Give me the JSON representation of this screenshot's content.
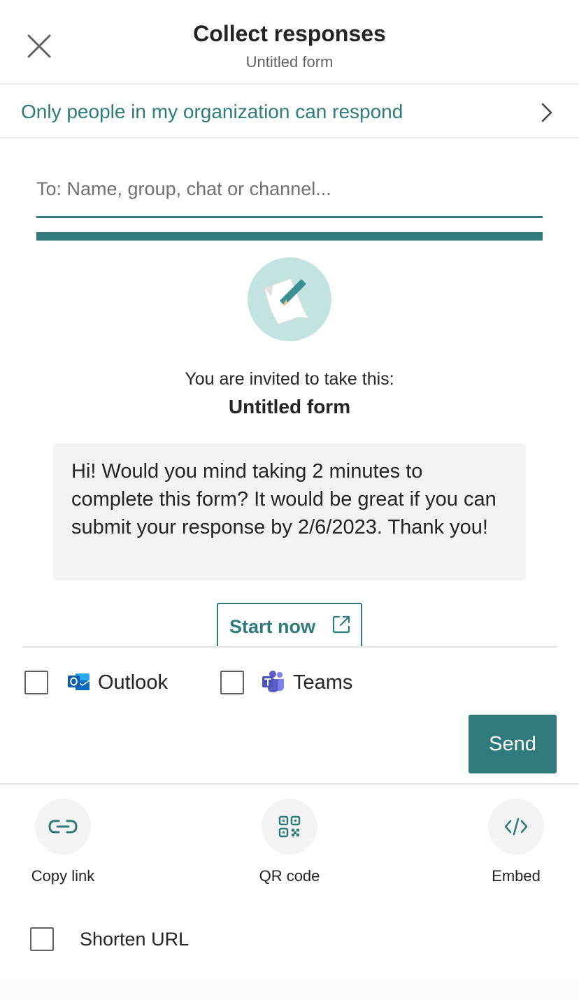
{
  "header": {
    "title": "Collect responses",
    "subtitle": "Untitled form"
  },
  "permission": {
    "label": "Only people in my organization can respond"
  },
  "recipients": {
    "placeholder": "To: Name, group, chat or channel...",
    "value": ""
  },
  "preview": {
    "invite_text": "You are invited to take this:",
    "form_title": "Untitled form",
    "message": "Hi! Would you mind taking 2 minutes to complete this form? It would be great if you can submit your response by 2/6/2023. Thank you!",
    "start_label": "Start now"
  },
  "channels": {
    "outlook": {
      "label": "Outlook",
      "checked": false
    },
    "teams": {
      "label": "Teams",
      "checked": false
    }
  },
  "send_label": "Send",
  "share_options": {
    "copy_link": "Copy link",
    "qr_code": "QR code",
    "embed": "Embed"
  },
  "shorten_url": {
    "label": "Shorten URL",
    "checked": false
  },
  "icons": {
    "close": "close-icon",
    "chevron": "chevron-right-icon",
    "external": "open-external-icon",
    "outlook": "outlook-icon",
    "teams": "teams-icon",
    "link": "link-icon",
    "qr": "qr-code-icon",
    "embed": "code-icon",
    "form": "form-pencil-icon"
  },
  "colors": {
    "accent": "#2f7a7b",
    "icon_bg": "#c3e3e1",
    "message_bg": "#f3f3f3",
    "outlook": "#0f6cbd",
    "teams": "#5b5fc7"
  }
}
